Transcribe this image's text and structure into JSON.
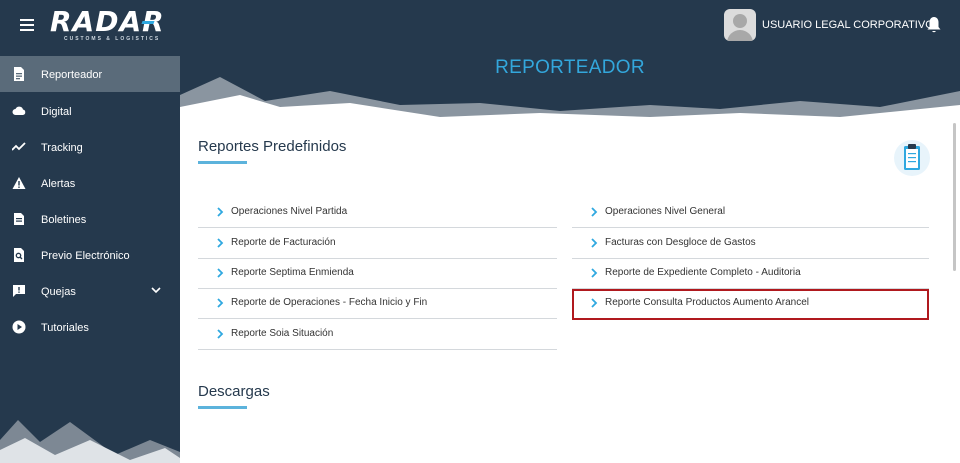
{
  "header": {
    "logo_text": "RADAR",
    "logo_subtitle": "CUSTOMS & LOGISTICS",
    "username": "USUARIO LEGAL CORPORATIVO",
    "page_title": "REPORTEADOR"
  },
  "sidebar": {
    "items": [
      {
        "label": "Reporteador",
        "icon": "document-icon",
        "active": true
      },
      {
        "label": "Digital",
        "icon": "cloud-icon"
      },
      {
        "label": "Tracking",
        "icon": "trending-icon"
      },
      {
        "label": "Alertas",
        "icon": "warning-icon"
      },
      {
        "label": "Boletines",
        "icon": "newspaper-icon"
      },
      {
        "label": "Previo Electrónico",
        "icon": "search-document-icon"
      },
      {
        "label": "Quejas",
        "icon": "feedback-icon",
        "expandable": true
      },
      {
        "label": "Tutoriales",
        "icon": "play-circle-icon"
      }
    ]
  },
  "main": {
    "predefined_title": "Reportes Predefinidos",
    "downloads_title": "Descargas",
    "left_reports": [
      "Operaciones Nivel Partida",
      "Reporte de Facturación",
      "Reporte Septima Enmienda",
      "Reporte de Operaciones - Fecha Inicio y Fin",
      "Reporte Soia Situación"
    ],
    "right_reports": [
      "Operaciones Nivel General",
      "Facturas con Desgloce de Gastos",
      "Reporte de Expediente Completo - Auditoria",
      "Reporte Consulta Productos Aumento Arancel"
    ],
    "highlighted_report": "Reporte Consulta Productos Aumento Arancel"
  },
  "colors": {
    "navy": "#25394d",
    "accent": "#33a7dc",
    "highlight_border": "#b0191e",
    "active_item": "#5a6b7a"
  }
}
